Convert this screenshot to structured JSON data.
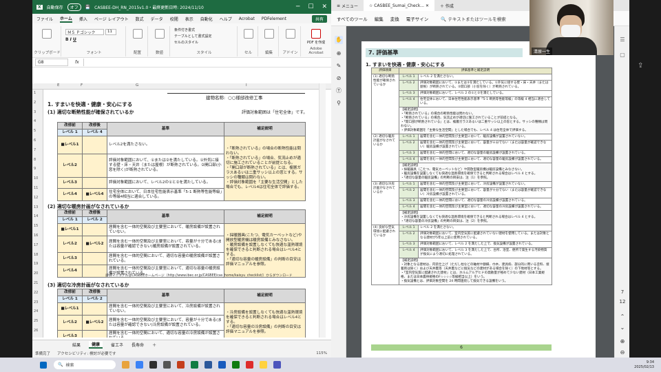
{
  "excel": {
    "autosave": "自動保存",
    "autosave_state": "オフ",
    "title": "CASBEE-DH_RN_2015v1.0・最終更新日時: 2024/11/10",
    "menu": [
      "ファイル",
      "ホーム",
      "挿入",
      "ページ レイアウト",
      "数式",
      "データ",
      "校閲",
      "表示",
      "自動化",
      "ヘルプ",
      "Acrobat",
      "PDFelement"
    ],
    "share": "共有",
    "ribbon": {
      "clipboard": "クリップボード",
      "font": "フォント",
      "font_name": "ＭＳ Ｐゴシック",
      "font_size": "11",
      "layout": "配置",
      "number": "数値",
      "style": "スタイル",
      "cell": "セル",
      "edit": "編集",
      "addin": "アドイン",
      "addin_label": "アドイン",
      "pdf": "Adobe Acrobat",
      "pdf_label": "PDF を作成",
      "cond_format": "条件付き書式",
      "table_format": "テーブルとして書式設定",
      "cell_style": "セルのスタイル"
    },
    "namebox": "G8",
    "fx": "fx",
    "col_headers": [
      "A",
      "B",
      "C",
      "D",
      "E",
      "F",
      "G",
      "H",
      "I",
      "J",
      "K"
    ],
    "row_headers": [
      "1",
      "2",
      "3",
      "4",
      "5",
      "6",
      "7",
      "8",
      "9",
      "10",
      "11",
      "12",
      "13",
      "14",
      "15",
      "16",
      "17",
      "18",
      "19",
      "20",
      "21",
      "22",
      "23",
      "24",
      "25",
      "26"
    ],
    "sheet": {
      "building_label": "建物名称:",
      "building_name": "○○様邸改修工事",
      "section_title": "1. すまいを快適・健康・安心にする",
      "scope_note": "評価対象範囲は「住宅全体」です。",
      "s1_title": "(1) 適切な断熱性能が確保されているか",
      "s2_title": "(2) 適切な暖房計画がなされているか",
      "s3_title": "(3) 適切な冷房計画がなされているか",
      "col_before": "改修前",
      "col_after": "改修後",
      "col_criteria": "基準",
      "col_notes": "補足説明",
      "s1_before": "レベル 1",
      "s1_after": "レベル 4",
      "s1_rows": [
        {
          "level": "■レベル1",
          "criteria": "レベル2を満たさない。"
        },
        {
          "level": "レベル2",
          "criteria": "評価対象範囲において、①または②を満たしている。①外気に接する壁・床・天井（または屋根）が断熱されている。②開口部(小窓を除く)が断熱されている。"
        },
        {
          "level": "レベル3",
          "criteria": "評価対象範囲において、レベル2の①と②を満たしている。"
        },
        {
          "level": "レベル4",
          "after": "■レベル4",
          "criteria": "住宅全体において、日本住宅性能表示基準「5-1 断熱等性能等級」の等級4相当に適合している。"
        }
      ],
      "s1_notes": [
        "・「断熱されている」の場合の断熱性能は問わない。",
        "・「断熱されている」の場合、気流止めが適切に施工されていることが前提となる。",
        "・「開口部が断熱されている」とは、複層ガラスあるいは二重サッシ以上の窓とする。サッシの種類は問わない。",
        "・評価対象範囲を「主要な生活空間」とした場合でも、レベル4は住宅全体で評価する。"
      ],
      "s2_before": "レベル 1",
      "s2_after": "レベル 2",
      "s2_rows": [
        {
          "level": "■レベル1",
          "after": "",
          "criteria": "居間を含む一体的空間及び主要室において、暖房設備が設置されていない。"
        },
        {
          "level": "レベル2",
          "after": "■レベル2",
          "criteria": "居間を含む一体的空間及び主要室において、容量が十分である(または容量が確認できない)暖房設備が設置されている。"
        },
        {
          "level": "レベル3",
          "after": "",
          "criteria": "居間を含む一体的空間において、適切な容量の暖房設備が設置されている。"
        },
        {
          "level": "レベル4",
          "after": "",
          "criteria": "居間を含む一体的空間及び主要室において、適切な容量の暖房設備が設置されている。"
        }
      ],
      "s2_notes": [
        "・採暖器具(こたつ、電気カーペットなど)や開放型暖房機は暖房設備とみなさない。",
        "・暖房設備を設置しなくても快適な温熱環境を確保できると判断される場合はレベル4とする。",
        "・「適切な容量の暖房設備」の判断の目安は評価マニュアルを参照。"
      ],
      "s2_link": "評価マニュアルはCASBEEホームページ（http://www.ibec.or.jp/CASBEE/cas_home/kaisyu_checklist/）からダウンロード",
      "s3_before": "レベル 1",
      "s3_after": "レベル 2",
      "s3_rows": [
        {
          "level": "■レベル1",
          "after": "",
          "criteria": "居間を含む一体的空間及び主要室において、冷房設備が設置されていない。"
        },
        {
          "level": "レベル2",
          "after": "■レベル2",
          "criteria": "居間を含む一体的空間及び主要室において、容量が十分である(または容量が確認できない)冷房設備が設置されている。"
        },
        {
          "level": "レベル3",
          "after": "",
          "criteria": "居間を含む一体的空間において、適切な容量の冷房設備が設置されている。"
        }
      ],
      "s3_notes": [
        "・冷房設備を設置しなくても快適な温熱環境を確保できると判断される場合はレベル4とする。",
        "・「適切な容量の冷房設備」の判断の目安は評価マニュアルを参照。"
      ]
    },
    "tabs": [
      "結果",
      "健康",
      "省エネ",
      "長寿命"
    ],
    "active_tab": "健康",
    "status": {
      "ready": "準備完了",
      "accessibility": "アクセシビリティ: 検討が必要です",
      "zoom": "115%"
    }
  },
  "pdf": {
    "tabs": [
      "メニュー",
      "CASBEE_Sumai_Check...",
      "作成"
    ],
    "toolbar": [
      "すべてのツール",
      "編集",
      "変換",
      "電子サイン"
    ],
    "search_hint": "テキストまたはツールを検索",
    "section_header": "7. 評価基準",
    "subtitle": "1. すまいを快適・健康・安心にする",
    "head_item": "評価項目",
    "head_crit": "評価基準と補足説明",
    "items": [
      {
        "name": "(1) 適切な断熱性能が確保されているか",
        "rows": [
          [
            "レベル 1",
            "レベル 2 を満たさない。"
          ],
          [
            "レベル 2",
            "評価対象範囲において、①または②を満たしている。①外気に接する壁・床・天井（または屋根）が断熱されている。②開口部（小窓を除く）が断熱されている。"
          ],
          [
            "レベル 3",
            "評価対象範囲において、レベル 2 の①と②を満たしている。"
          ],
          [
            "レベル 4",
            "住宅全体において、日本住宅性能表示基準「5-1 断熱等性能等級」の等級 4 相当に適合している。"
          ]
        ],
        "notes": [
          "【補足説明】",
          "・「断熱されている」の場合の断熱性能は問わない。",
          "・「断熱されている」の場合、気流止めが適切に施工されていることが前提となる。",
          "・「開口部が断熱されている」とは、複層ガラスあるいは二重サッシ以上の窓とする。サッシの種類は問わない。",
          "・評価対象範囲を「主要な生活空間」とした場合でも、レベル 4 は住宅全体で評価する。"
        ]
      },
      {
        "name": "(2) 適切な暖房計画がなされているか",
        "rows": [
          [
            "レベル 1",
            "居間を含む一体的空間及び主要室において、暖房設備が設置されていない。"
          ],
          [
            "レベル 2",
            "居間を含む一体的空間及び主要室において、容量が十分でない（または容量が確認できない）暖房設備が設置されている。"
          ],
          [
            "レベル 3",
            "居間を含む一体的空間において、適切な容量の暖房設備が設置されている。"
          ],
          [
            "レベル 4",
            "居間を含む一体的空間及び主要室において、適切な容量の暖房設備が設置されている。"
          ]
        ],
        "notes": [
          "【補足説明】",
          "・採暖器具（こたつ、電気カーペットなど）や開放型暖房機は暖房設備とみなさない。",
          "・暖房設備を設置しなくても快適な温熱環境を確保できると判断される場合はレベル 4 とする。",
          "・「適切な容量の暖房設備」の判断の目安は、注（1）を参照。"
        ]
      },
      {
        "name": "(3) 適切な冷房計画がなされているか",
        "rows": [
          [
            "レベル 1",
            "居間を含む一体的空間及び主要室において、冷房設備が設置されていない。"
          ],
          [
            "レベル 2",
            "居間を含む一体的空間及び主要室において、容量が十分でない（または容量が確認できない）冷房設備が設置されている。"
          ],
          [
            "レベル 3",
            "居間を含む一体的空間において、適切な容量の冷房設備が設置されている。"
          ],
          [
            "レベル 4",
            "居間を含む一体的空間及び主要室において、適切な容量の冷房設備が設置されている。"
          ]
        ],
        "notes": [
          "【補足説明】",
          "・冷房設備を設置しなくても快適な温熱環境を確保できると判断される場合はレベル 4 とする。",
          "・「適切な容量の冷房設備」の判断の目安は、注（2）を参照。"
        ]
      },
      {
        "name": "(4) 良好な空気環境に配慮されているか",
        "rows": [
          [
            "レベル 1",
            "レベル 2 を満たさない。"
          ],
          [
            "レベル 2",
            "評価対象範囲において、室内空気質に配慮されていない建材を使用している。または対象となる建材が5年以上前に使用されている。"
          ],
          [
            "レベル 3",
            "評価対象範囲において、レベル 2 を満たした上で、換気設備が設置されている。"
          ],
          [
            "レベル 4",
            "評価対象範囲において、レベル 3 を満たした上で、台所、浴室、便所で発生する汚染物質が換気により適切に処理されている。"
          ]
        ],
        "notes": [
          "【補足説明】",
          "・対象となる建材は、内装仕上げ（ただし柱などの軸材や額縁、巾木、建具枠、部分的に用いる塗料、接着剤は除く）および天井裏等（天井裏などに換気などの建材がある場合を除く）の下地材等とする。",
          "・「室内空気質に配慮された建材」とは、ホルムアルデヒドの発散量が極めて少ない建材（日本工業規格、または日本農林規格のF☆☆☆☆等級相当以上）をいう。",
          "・換気設備とは、評価対象空間を 24 時間連続して換気できる設備をいう。"
        ]
      }
    ],
    "footer_page": "6",
    "page_indicator": [
      "7",
      "12"
    ]
  },
  "webcam": {
    "name": "清原一生"
  },
  "taskbar": {
    "search_placeholder": "検索",
    "time": "9:34",
    "date": "2025/02/13"
  }
}
